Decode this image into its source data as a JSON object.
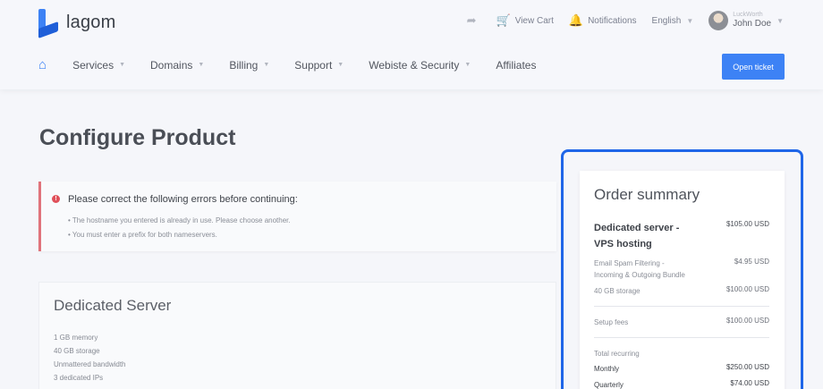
{
  "brand": {
    "name": "lagom"
  },
  "utility": {
    "view_cart": "View Cart",
    "notifications": "Notifications",
    "language": "English",
    "user_small": "LuckWorth",
    "user_name": "John Doe"
  },
  "nav": {
    "items": [
      "Services",
      "Domains",
      "Billing",
      "Support",
      "Webiste & Security",
      "Affiliates"
    ],
    "cta": "Open ticket"
  },
  "page": {
    "title": "Configure Product"
  },
  "alert": {
    "heading": "Please correct the following errors before continuing:",
    "errors": [
      "The hostname you entered is already in use. Please choose another.",
      "You must enter a prefix for both nameservers."
    ]
  },
  "product": {
    "name": "Dedicated Server",
    "features": [
      "1 GB memory",
      "40 GB storage",
      "Unmattered bandwidth",
      "3 dedicated IPs"
    ]
  },
  "summary": {
    "title": "Order summary",
    "product_name_line1": "Dedicated server -",
    "product_name_line2": "VPS hosting",
    "product_price": "$105.00 USD",
    "addon1_line1": "Email Spam Filtering -",
    "addon1_line2": "Incoming & Outgoing Bundle",
    "addon1_price": "$4.95 USD",
    "addon2": "40 GB storage",
    "addon2_price": "$100.00 USD",
    "setup_label": "Setup fees",
    "setup_price": "$100.00 USD",
    "recurring_label": "Total recurring",
    "monthly_label": "Monthly",
    "monthly_price": "$250.00 USD",
    "quarterly_label": "Quarterly",
    "quarterly_price": "$74.00 USD"
  },
  "colors": {
    "accent": "#3d82f5",
    "error": "#e0505a",
    "highlight": "#1f66e8"
  }
}
